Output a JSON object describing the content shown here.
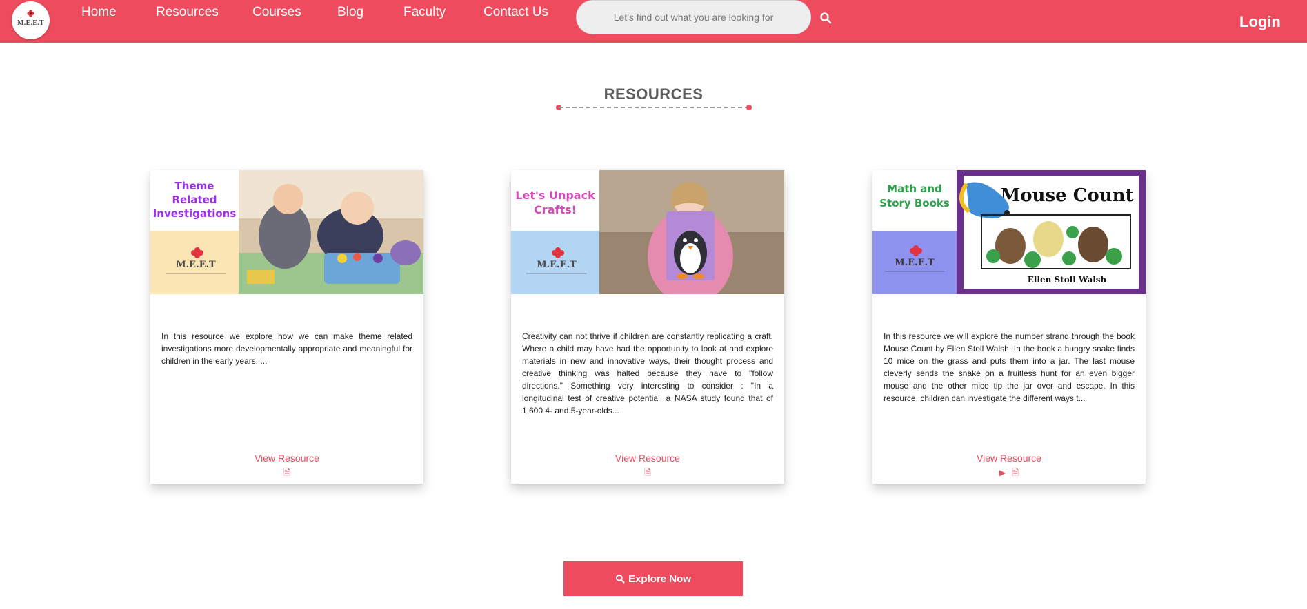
{
  "brand": {
    "logo_text": "M.E.E.T",
    "accent": "#ef4b5e"
  },
  "nav": {
    "items": [
      {
        "label": "Home"
      },
      {
        "label": "Resources"
      },
      {
        "label": "Courses"
      },
      {
        "label": "Blog"
      },
      {
        "label": "Faculty"
      },
      {
        "label": "Contact Us"
      }
    ],
    "search_placeholder": "Let's find out what you are looking for",
    "search_icon": "search-icon",
    "login_label": "Login"
  },
  "section": {
    "title": "RESOURCES"
  },
  "cards": [
    {
      "thumb_title": "Theme Related Investigations",
      "thumb_logo": "M.E.E.T",
      "description": "In this resource we explore how we can make theme related investigations more developmentally appropriate and meaningful for children in the early years. ...",
      "link_label": "View Resource",
      "icons": [
        "document-icon"
      ]
    },
    {
      "thumb_title": "Let's Unpack Crafts!",
      "thumb_logo": "M.E.E.T",
      "description": "Creativity can not thrive if children are constantly replicating a craft. Where a child may have had the opportunity to look at and explore materials in new and innovative ways, their thought process and creative thinking was halted because they have to \"follow directions.\" Something very interesting to consider : \"In a longitudinal test of creative potential, a NASA study found that of 1,600 4- and 5-year-olds...",
      "link_label": "View Resource",
      "icons": [
        "document-icon"
      ]
    },
    {
      "thumb_title": "Math and Story Books",
      "thumb_logo": "M.E.E.T",
      "thumb_book_title": "Mouse Count",
      "thumb_book_author": "Ellen Stoll Walsh",
      "description": "In this resource we will explore the number strand through the book Mouse Count by Ellen Stoll Walsh. In the book a hungry snake finds 10 mice on the grass and puts them into a jar. The last mouse cleverly sends the snake on a fruitless hunt for an even bigger mouse and the other mice tip the jar over and escape. In this resource, children can investigate the different ways t...",
      "link_label": "View Resource",
      "icons": [
        "play-icon",
        "document-icon"
      ]
    }
  ],
  "explore": {
    "label": "Explore Now",
    "icon": "search-icon"
  }
}
